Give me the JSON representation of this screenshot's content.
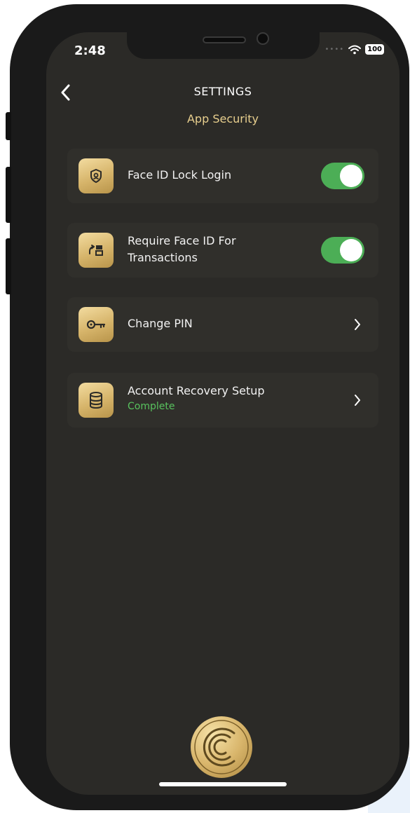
{
  "status_bar": {
    "time": "2:48",
    "battery": "100"
  },
  "header": {
    "title": "SETTINGS",
    "subtitle": "App Security"
  },
  "settings": {
    "items": [
      {
        "label": "Face ID Lock Login",
        "icon": "shield-face-icon",
        "control": "toggle",
        "enabled": true
      },
      {
        "label": "Require Face ID For Transactions",
        "line1": "Require Face ID For",
        "line2": "Transactions",
        "icon": "transfer-icon",
        "control": "toggle",
        "enabled": true
      },
      {
        "label": "Change PIN",
        "icon": "key-icon",
        "control": "chevron"
      },
      {
        "label": "Account Recovery Setup",
        "status": "Complete",
        "icon": "database-icon",
        "control": "chevron"
      }
    ]
  },
  "colors": {
    "background": "#2b2a27",
    "accent_gold": "#e8cf8e",
    "toggle_on": "#4cae56",
    "status_complete": "#58c25e"
  }
}
